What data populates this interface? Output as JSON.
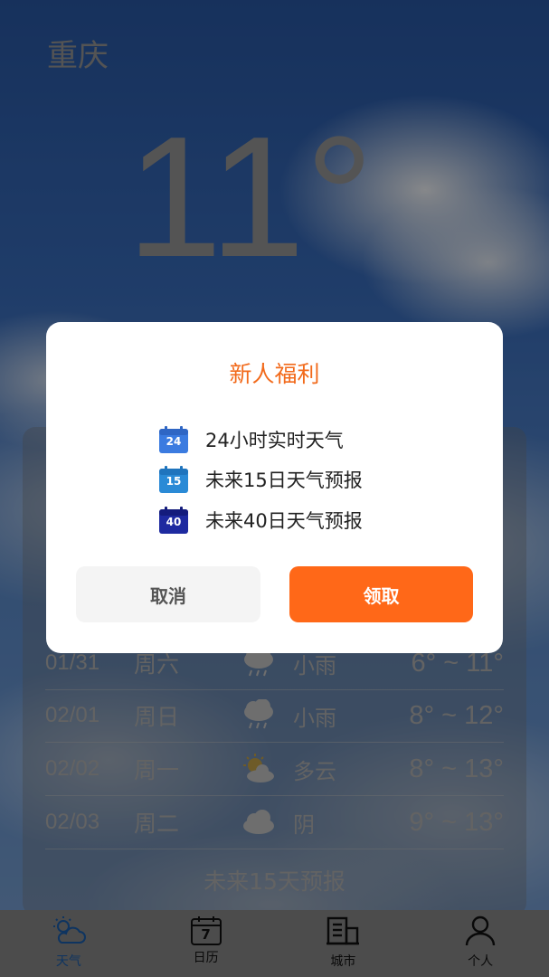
{
  "city": "重庆",
  "current_temp": "11°",
  "forecast": [
    {
      "date": "01/31",
      "weekday": "周六",
      "icon": "rain-icon",
      "desc": "小雨",
      "range": "6° ~ 11°"
    },
    {
      "date": "02/01",
      "weekday": "周日",
      "icon": "rain-icon",
      "desc": "小雨",
      "range": "8° ~ 12°"
    },
    {
      "date": "02/02",
      "weekday": "周一",
      "icon": "partly-cloudy-icon",
      "desc": "多云",
      "range": "8° ~ 13°"
    },
    {
      "date": "02/03",
      "weekday": "周二",
      "icon": "cloud-icon",
      "desc": "阴",
      "range": "9° ~ 13°"
    }
  ],
  "more_forecast": "未来15天预报",
  "modal": {
    "title": "新人福利",
    "features": [
      {
        "badge": "24",
        "text": "24小时实时天气",
        "color": "#3b7be0"
      },
      {
        "badge": "15",
        "text": "未来15日天气预报",
        "color": "#2a8ad6"
      },
      {
        "badge": "40",
        "text": "未来40日天气预报",
        "color": "#1e2aa0"
      }
    ],
    "cancel": "取消",
    "confirm": "领取"
  },
  "tabs": [
    {
      "label": "天气",
      "icon": "weather-icon",
      "active": true
    },
    {
      "label": "日历",
      "icon": "calendar-icon",
      "badge": "7"
    },
    {
      "label": "城市",
      "icon": "city-icon"
    },
    {
      "label": "个人",
      "icon": "person-icon"
    }
  ],
  "colors": {
    "accent": "#ff6818",
    "title": "#f26a1b",
    "tab_active": "#1a5fb0"
  }
}
